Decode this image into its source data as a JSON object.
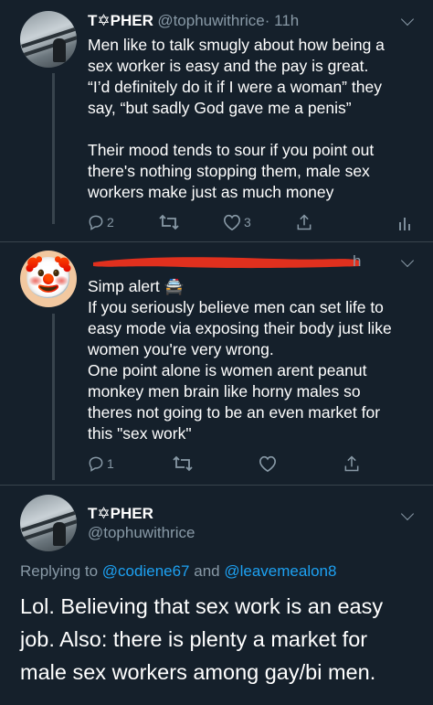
{
  "tweet1": {
    "name": "T✡PHER",
    "handle": "@tophuwithrice",
    "time": "· 11h",
    "text": "Men like to talk smugly about how being a\nsex worker is easy and the pay is great.\n“I’d definitely do it if I were a woman” they\nsay, “but sadly God gave me a penis”\n\nTheir mood tends to sour if you point out\nthere's nothing stopping them, male sex\nworkers make just as much money",
    "reply_count": "2",
    "like_count": "3"
  },
  "tweet2": {
    "time_partial": "h",
    "text": "Simp alert 🚔\nIf you seriously believe men can set life to\neasy mode via exposing their body just like\nwomen you're very wrong.\nOne point alone is women arent peanut\nmonkey men brain like horny males so\ntheres not going to be an even market for\nthis \"sex work\"",
    "reply_count": "1",
    "avatar_emoji": "🤡"
  },
  "tweet3": {
    "name": "T✡PHER",
    "handle": "@tophuwithrice",
    "replying_prefix": "Replying to",
    "mention1": "@codiene67",
    "and_word": "and",
    "mention2": "@leavemealon8",
    "text": "Lol. Believing that sex work is an easy\njob. Also: there is plenty a market for\nmale sex workers among gay/bi men."
  },
  "colors": {
    "background": "#15202b",
    "secondary_text": "#8899a6",
    "link": "#1da1f2",
    "redaction": "#e0301e",
    "divider": "#38444d"
  }
}
